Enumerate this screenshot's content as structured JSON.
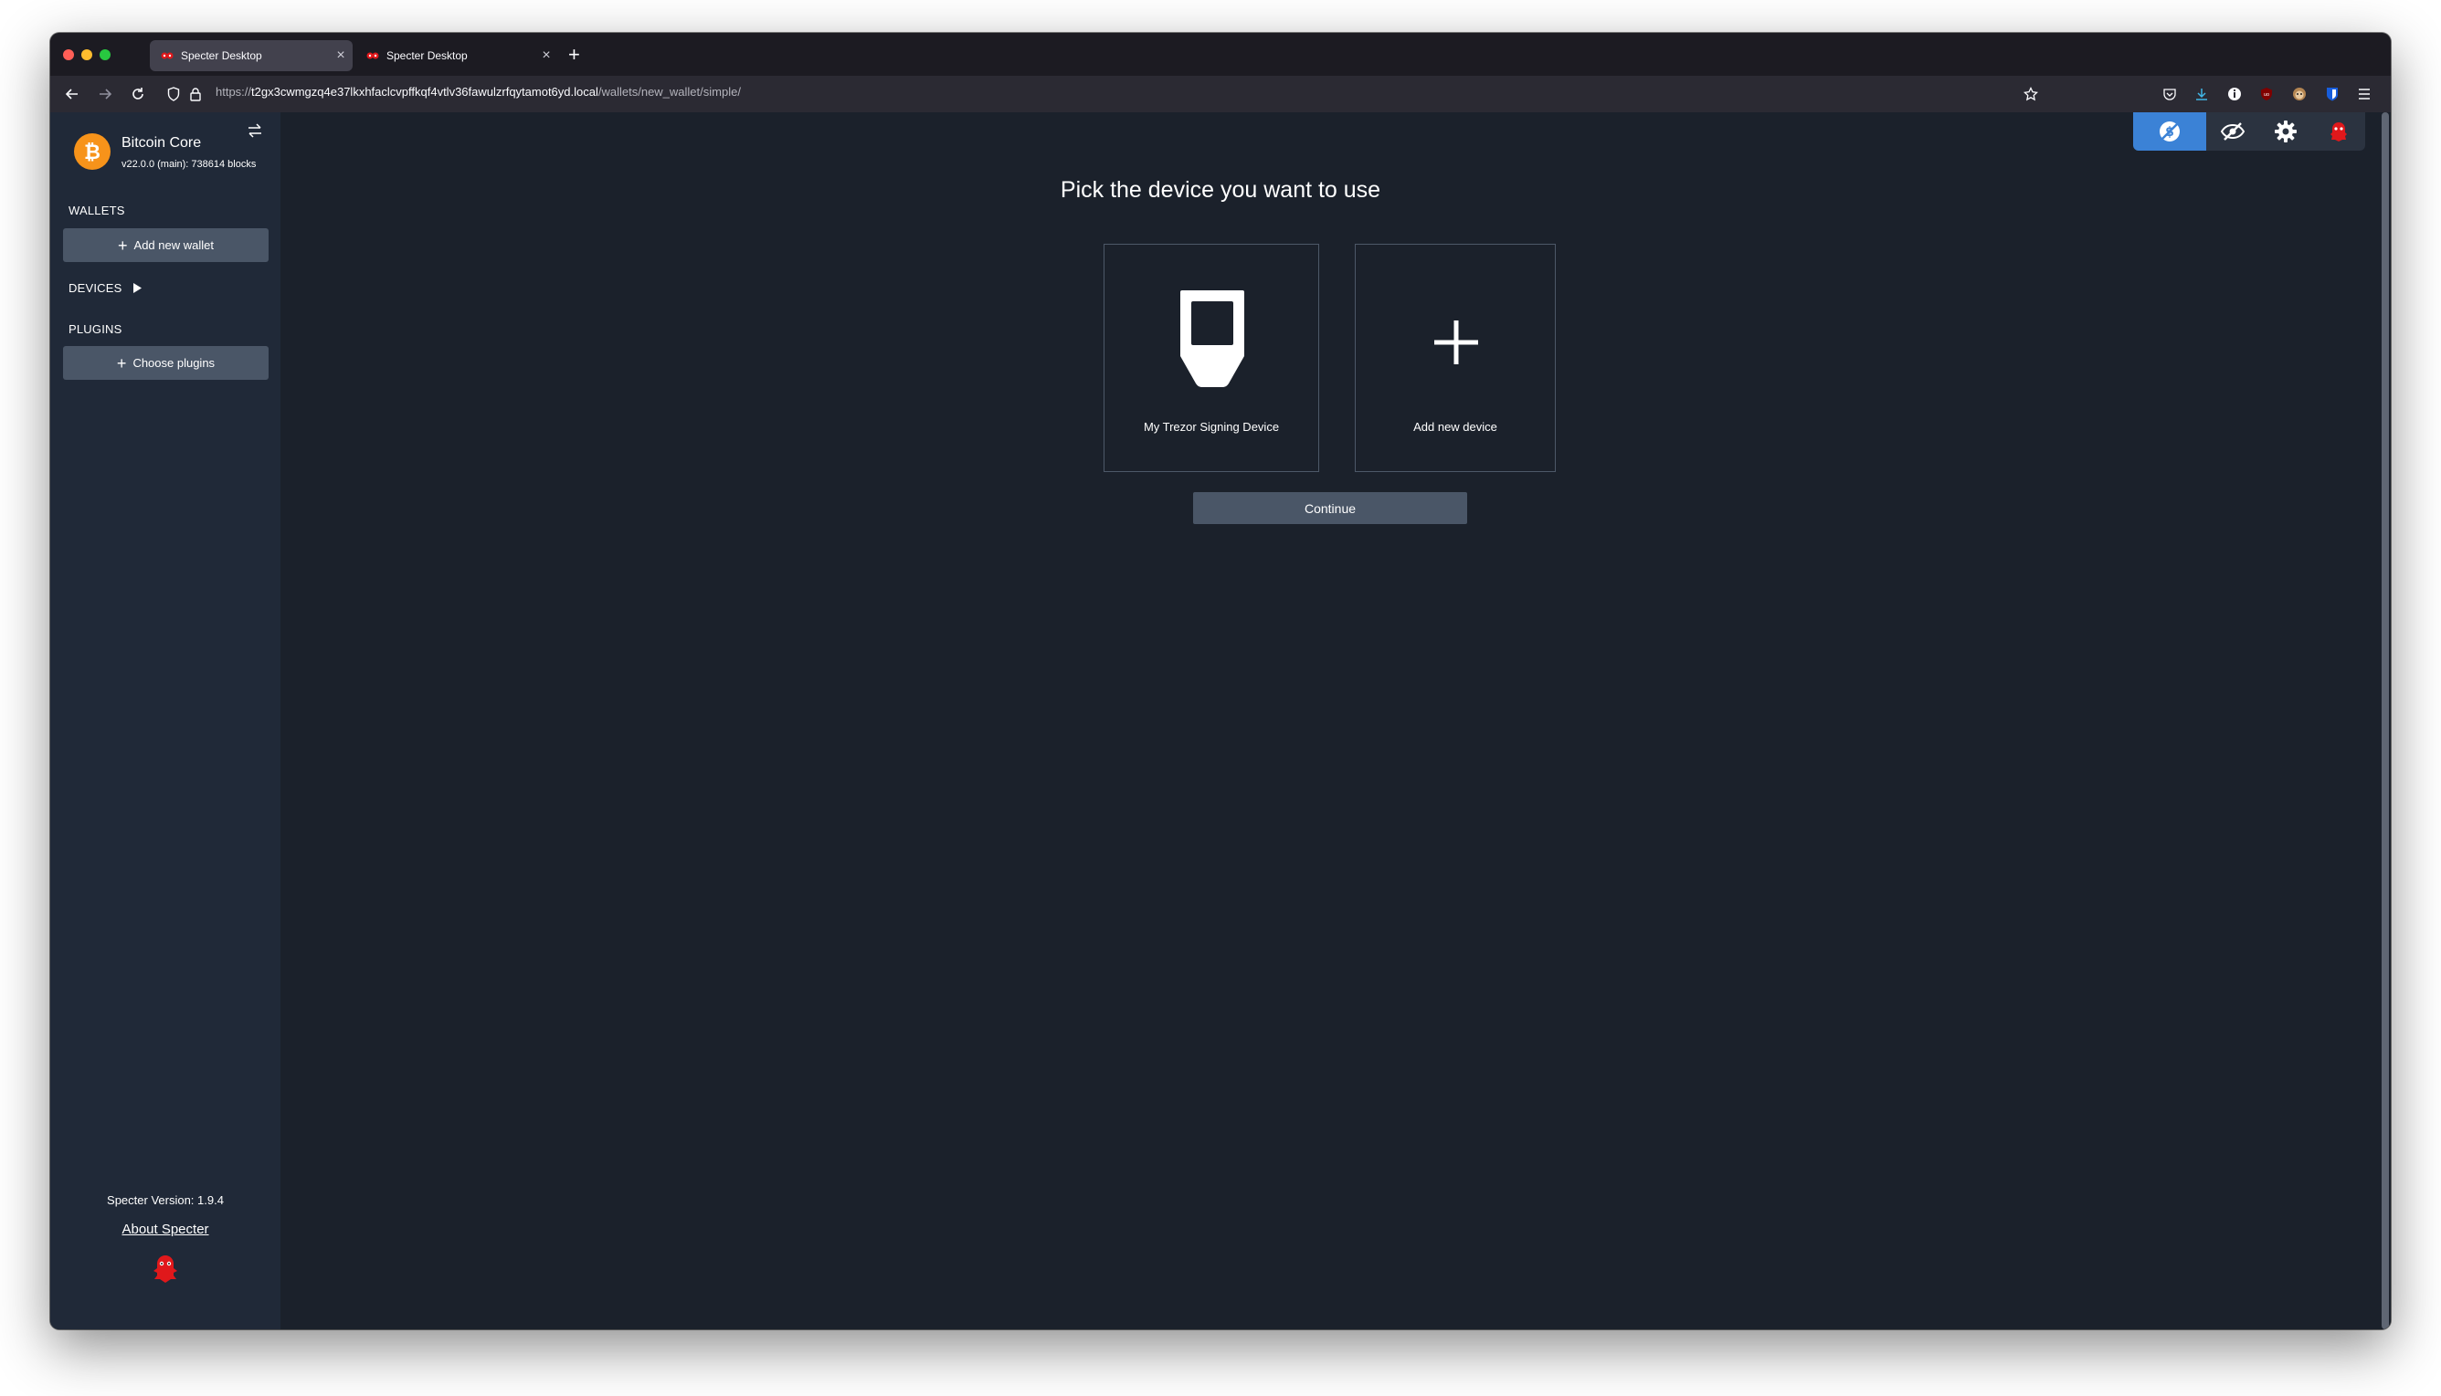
{
  "browser": {
    "tabs": [
      {
        "title": "Specter Desktop",
        "close": "×"
      },
      {
        "title": "Specter Desktop",
        "close": "×"
      }
    ],
    "new_tab": "+",
    "url": {
      "scheme": "https://",
      "host": "t2gx3cwmgzq4e37lkxhfaclcvpffkqf4vtlv36fawulzrfqytamot6yd.local",
      "path": "/wallets/new_wallet/simple/"
    }
  },
  "sidebar": {
    "node": {
      "name": "Bitcoin Core",
      "status": "v22.0.0 (main): 738614 blocks"
    },
    "wallets_label": "WALLETS",
    "add_wallet_label": "Add new wallet",
    "devices_label": "DEVICES",
    "plugins_label": "PLUGINS",
    "choose_plugins_label": "Choose plugins",
    "version_prefix": "Specter Version: ",
    "version": "1.9.4",
    "about_label": "About Specter"
  },
  "main": {
    "heading": "Pick the device you want to use",
    "devices": [
      {
        "label": "My Trezor Signing Device",
        "icon": "trezor-icon"
      },
      {
        "label": "Add new device",
        "icon": "plus-icon"
      }
    ],
    "continue_label": "Continue"
  },
  "colors": {
    "background": "#1b212b",
    "sidebar": "#202938",
    "button": "#4a5667",
    "accent_blue": "#3b82d6",
    "bitcoin_orange": "#f7931a",
    "specter_red": "#e0181b"
  }
}
